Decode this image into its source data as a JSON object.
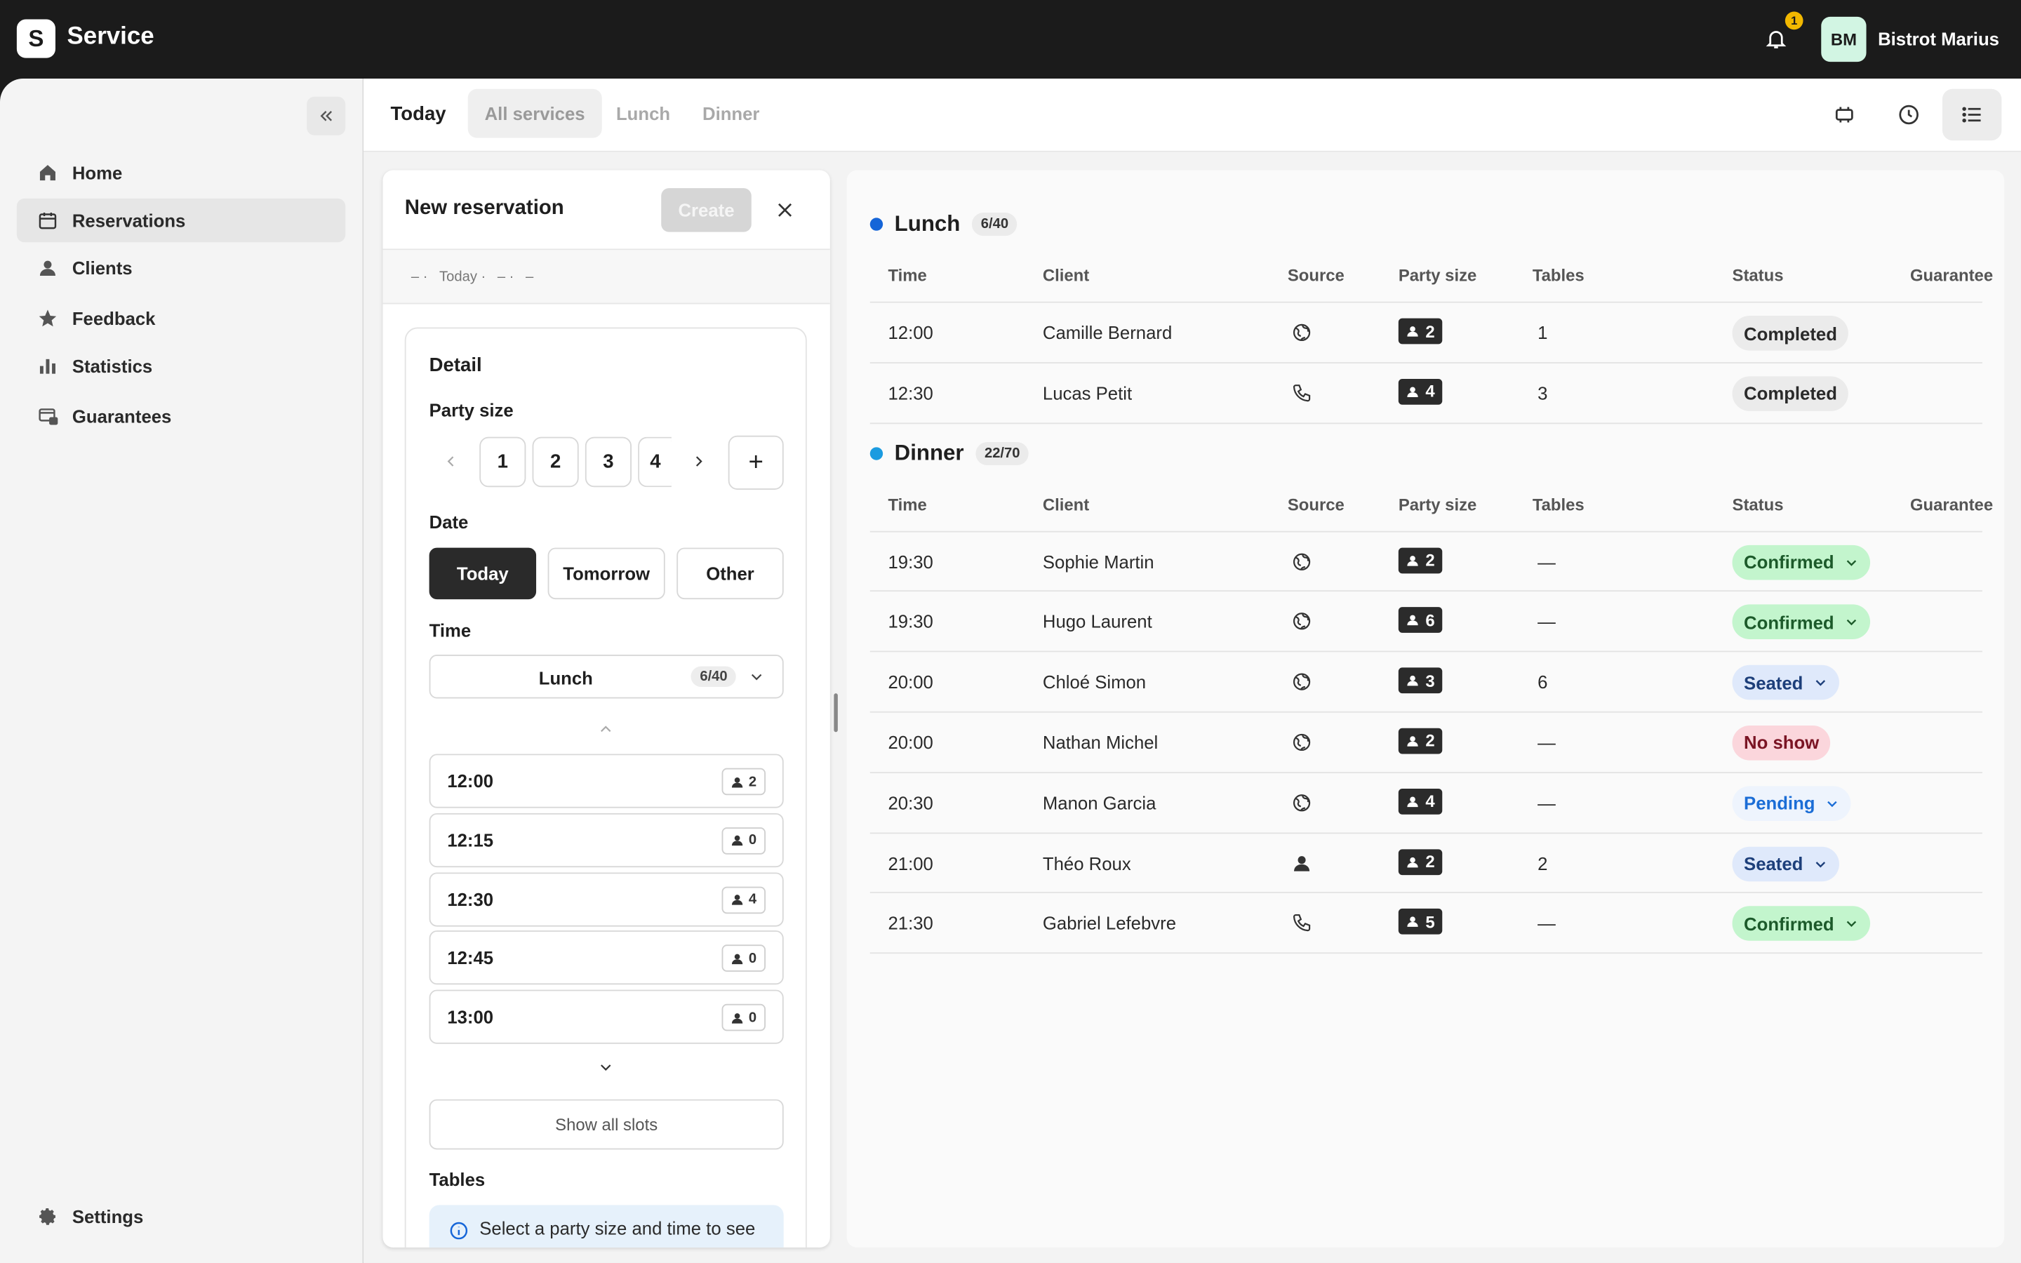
{
  "app": {
    "logo_letter": "S",
    "title": "Service",
    "notification_count": "1",
    "user_initials": "BM",
    "user_name": "Bistrot Marius"
  },
  "sidebar": {
    "items": [
      {
        "label": "Home",
        "icon": "home-icon"
      },
      {
        "label": "Reservations",
        "icon": "calendar-icon",
        "active": true
      },
      {
        "label": "Clients",
        "icon": "person-icon"
      },
      {
        "label": "Feedback",
        "icon": "star-icon"
      },
      {
        "label": "Statistics",
        "icon": "bar-chart-icon"
      },
      {
        "label": "Guarantees",
        "icon": "card-lock-icon"
      }
    ],
    "settings_label": "Settings"
  },
  "tabs": {
    "today": "Today",
    "all": "All services",
    "lunch": "Lunch",
    "dinner": "Dinner"
  },
  "panel": {
    "title": "New reservation",
    "create_label": "Create",
    "crumbs": [
      "– ·",
      "Today ·",
      "– ·",
      "–"
    ],
    "detail_label": "Detail",
    "party_size_label": "Party size",
    "party_sizes": [
      "1",
      "2",
      "3",
      "4"
    ],
    "plus_label": "+",
    "date_label": "Date",
    "dates": [
      "Today",
      "Tomorrow",
      "Other"
    ],
    "time_label": "Time",
    "time_select": {
      "value": "Lunch",
      "badge": "6/40"
    },
    "slots": [
      {
        "time": "12:00",
        "count": "2"
      },
      {
        "time": "12:15",
        "count": "0"
      },
      {
        "time": "12:30",
        "count": "4"
      },
      {
        "time": "12:45",
        "count": "0"
      },
      {
        "time": "13:00",
        "count": "0"
      }
    ],
    "show_all_label": "Show all slots",
    "tables_label": "Tables",
    "tables_info": "Select a party size and time to see"
  },
  "columns": {
    "time": "Time",
    "client": "Client",
    "source": "Source",
    "party": "Party size",
    "tables": "Tables",
    "status": "Status",
    "guarantee": "Guarantee"
  },
  "services": [
    {
      "name": "Lunch",
      "badge": "6/40",
      "color": "#1565d8",
      "rows": [
        {
          "time": "12:00",
          "client": "Camille Bernard",
          "source": "web",
          "party": "2",
          "tables": "1",
          "status": "Completed",
          "kind": "completed"
        },
        {
          "time": "12:30",
          "client": "Lucas Petit",
          "source": "phone",
          "party": "4",
          "tables": "3",
          "status": "Completed",
          "kind": "completed"
        }
      ]
    },
    {
      "name": "Dinner",
      "badge": "22/70",
      "color": "#1b9be0",
      "rows": [
        {
          "time": "19:30",
          "client": "Sophie Martin",
          "source": "web",
          "party": "2",
          "tables": "—",
          "status": "Confirmed",
          "kind": "confirmed"
        },
        {
          "time": "19:30",
          "client": "Hugo Laurent",
          "source": "web",
          "party": "6",
          "tables": "—",
          "status": "Confirmed",
          "kind": "confirmed"
        },
        {
          "time": "20:00",
          "client": "Chloé Simon",
          "source": "web",
          "party": "3",
          "tables": "6",
          "status": "Seated",
          "kind": "seated"
        },
        {
          "time": "20:00",
          "client": "Nathan Michel",
          "source": "web",
          "party": "2",
          "tables": "—",
          "status": "No show",
          "kind": "noshow"
        },
        {
          "time": "20:30",
          "client": "Manon Garcia",
          "source": "web",
          "party": "4",
          "tables": "—",
          "status": "Pending",
          "kind": "pending"
        },
        {
          "time": "21:00",
          "client": "Théo Roux",
          "source": "walkin",
          "party": "2",
          "tables": "2",
          "status": "Seated",
          "kind": "seated"
        },
        {
          "time": "21:30",
          "client": "Gabriel Lefebvre",
          "source": "phone",
          "party": "5",
          "tables": "—",
          "status": "Confirmed",
          "kind": "confirmed"
        }
      ]
    }
  ]
}
